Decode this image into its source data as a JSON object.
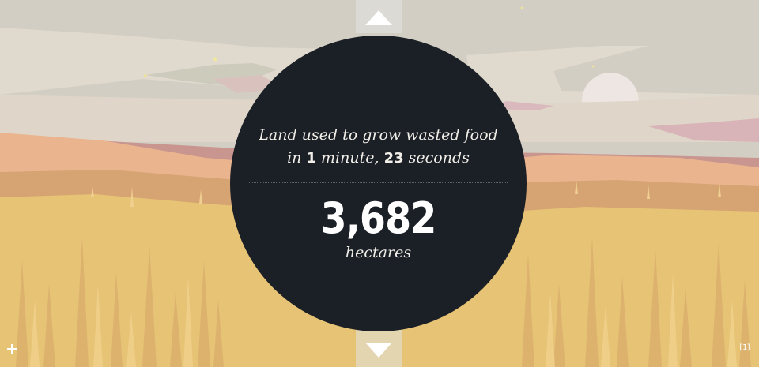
{
  "caption": {
    "line1": "Land used to grow wasted food",
    "line2_prefix": "in ",
    "minutes": "1",
    "minutes_label": " minute, ",
    "seconds": "23",
    "seconds_label": " seconds"
  },
  "stat": {
    "value": "3,682",
    "unit": "hectares"
  },
  "footnote": {
    "label": "[1]"
  },
  "colors": {
    "circle_bg": "#1b1f26",
    "sky": "#d4cfc4",
    "field": "#e5c273",
    "accent_text": "#f2efe9"
  },
  "icons": {
    "prev": "arrow-up-icon",
    "next": "arrow-down-icon",
    "more": "plus-icon"
  }
}
